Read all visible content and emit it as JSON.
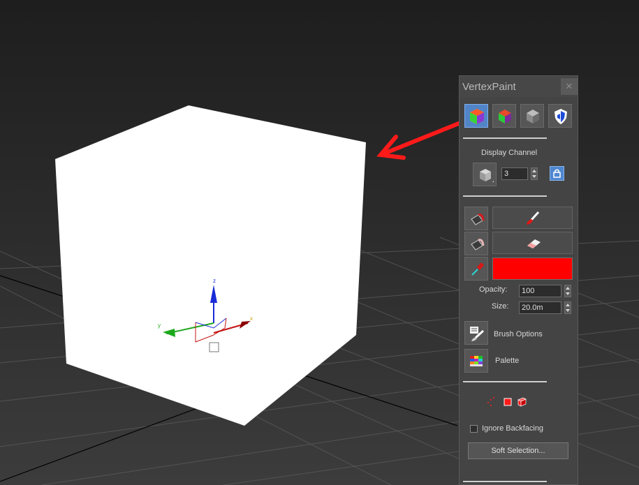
{
  "panel": {
    "title": "VertexPaint",
    "close_glyph": "✕",
    "toolbar_icons": [
      "vertex-color-cube-icon",
      "rgb-cube-icon",
      "gray-cube-icon",
      "shield-icon"
    ],
    "display_channel": {
      "label": "Display Channel",
      "value": "3",
      "icon": "channel-cube-icon",
      "lock_icon": "lock-icon"
    },
    "tools": {
      "paint_icon": "paintbrush-icon",
      "erase_icon": "eraser-icon",
      "pick_icon": "eyedropper-icon",
      "paint_mode_icon": "paint-bucket-icon",
      "erase_mode_icon": "erase-bucket-icon",
      "color": "#ff0000"
    },
    "opacity": {
      "label": "Opacity:",
      "value": "100"
    },
    "size": {
      "label": "Size:",
      "value": "20.0m"
    },
    "brush_options": {
      "label": "Brush Options",
      "icon": "brush-options-icon"
    },
    "palette": {
      "label": "Palette",
      "icon": "palette-icon"
    },
    "selection_modes": [
      "vertex-select-icon",
      "face-select-icon",
      "element-select-icon"
    ],
    "ignore_backfacing": {
      "label": "Ignore Backfacing",
      "checked": false
    },
    "soft_selection": {
      "label": "Soft Selection..."
    }
  },
  "viewport": {
    "cube_color": "#ffffff",
    "axis_labels": {
      "x": "x",
      "y": "y",
      "z": "z"
    },
    "annotation_arrow_color": "#ff1a1a"
  }
}
